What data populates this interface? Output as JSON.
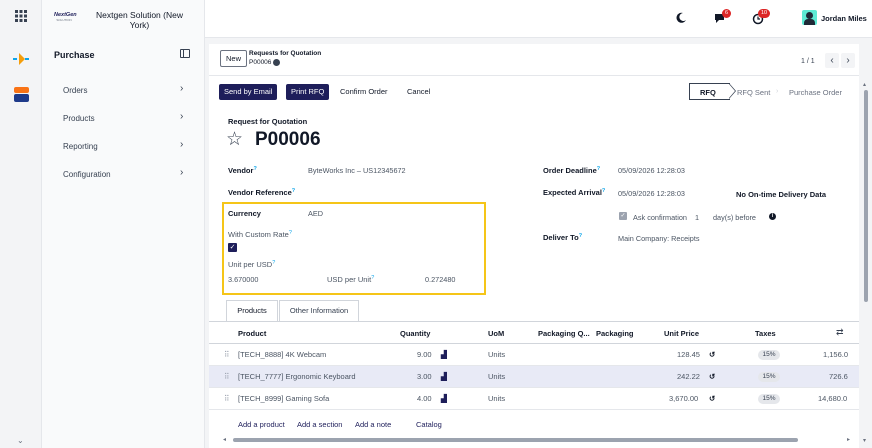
{
  "company": {
    "logo_text": "NextGen",
    "logo_sub": "SOLUTION",
    "name": "Nextgen Solution (New York)"
  },
  "app": {
    "title": "Purchase"
  },
  "menu": [
    {
      "label": "Orders"
    },
    {
      "label": "Products"
    },
    {
      "label": "Reporting"
    },
    {
      "label": "Configuration"
    }
  ],
  "systray": {
    "messages_count": "6",
    "activity_count": "10",
    "user_name": "Jordan Miles"
  },
  "breadcrumb": {
    "new_label": "New",
    "parent": "Requests for Quotation",
    "record": "P00006"
  },
  "pager": {
    "text": "1 / 1"
  },
  "actions": {
    "send_email": "Send by Email",
    "print_rfq": "Print RFQ",
    "confirm_order": "Confirm Order",
    "cancel": "Cancel"
  },
  "status": {
    "rfq": "RFQ",
    "rfq_sent": "RFQ Sent",
    "purchase_order": "Purchase Order"
  },
  "form": {
    "doc_type": "Request for Quotation",
    "name": "P00006",
    "vendor_label": "Vendor",
    "vendor_value": "ByteWorks Inc – US12345672",
    "vendor_ref_label": "Vendor Reference",
    "currency_label": "Currency",
    "currency_value": "AED",
    "custom_rate_label": "With Custom Rate",
    "unit_per_usd_label": "Unit per USD",
    "unit_per_usd_value": "3.670000",
    "usd_per_unit_label": "USD per Unit",
    "usd_per_unit_value": "0.272480",
    "order_deadline_label": "Order Deadline",
    "order_deadline_value": "05/09/2026 12:28:03",
    "expected_arrival_label": "Expected Arrival",
    "expected_arrival_value": "05/09/2026 12:28:03",
    "on_time_label": "No On-time Delivery Data",
    "ask_confirmation_label": "Ask confirmation",
    "ask_confirmation_days": "1",
    "days_before_label": "day(s) before",
    "deliver_to_label": "Deliver To",
    "deliver_to_value": "Main Company: Receipts"
  },
  "tabs": {
    "products": "Products",
    "other_info": "Other Information"
  },
  "table": {
    "headers": {
      "product": "Product",
      "quantity": "Quantity",
      "uom": "UoM",
      "packaging_qty": "Packaging Q...",
      "packaging": "Packaging",
      "unit_price": "Unit Price",
      "taxes": "Taxes"
    },
    "rows": [
      {
        "product": "[TECH_8888] 4K Webcam",
        "quantity": "9.00",
        "uom": "Units",
        "unit_price": "128.45",
        "tax": "15%",
        "subtotal": "1,156.0"
      },
      {
        "product": "[TECH_7777] Ergonomic Keyboard",
        "quantity": "3.00",
        "uom": "Units",
        "unit_price": "242.22",
        "tax": "15%",
        "subtotal": "726.6"
      },
      {
        "product": "[TECH_8999] Gaming Sofa",
        "quantity": "4.00",
        "uom": "Units",
        "unit_price": "3,670.00",
        "tax": "15%",
        "subtotal": "14,680.0"
      }
    ],
    "add_product": "Add a product",
    "add_section": "Add a section",
    "add_note": "Add a note",
    "catalog": "Catalog"
  },
  "colors": {
    "primary": "#1e1e5a",
    "highlight": "#f5c518",
    "badge_red": "#dc2626",
    "selected_row": "#e8eaf6"
  }
}
